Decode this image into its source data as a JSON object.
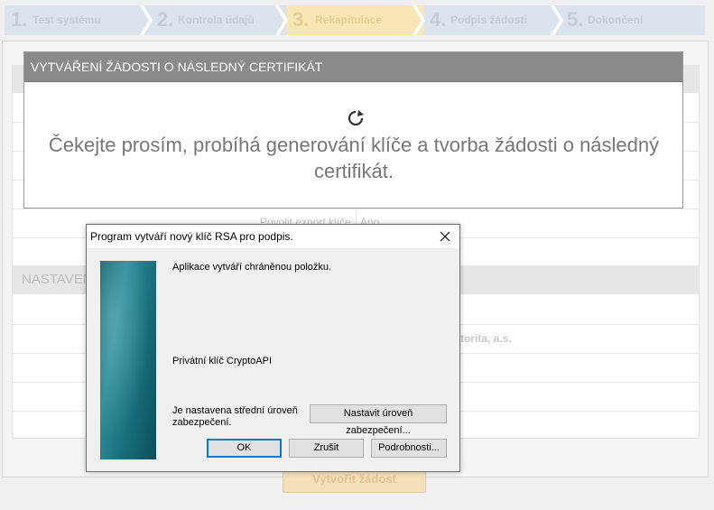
{
  "steps": [
    {
      "num": "1.",
      "label": "Test systému",
      "active": false
    },
    {
      "num": "2.",
      "label": "Kontrola údajů",
      "active": false
    },
    {
      "num": "3.",
      "label": "Rekapitulace",
      "active": true
    },
    {
      "num": "4.",
      "label": "Podpis žádosti",
      "active": false
    },
    {
      "num": "5.",
      "label": "Dokončení",
      "active": false
    }
  ],
  "form": {
    "export_label": "Povolit export klíče",
    "export_value": "Ano",
    "section_title": "NASTAVENÍ",
    "authority_value": "autorita, a.s.",
    "submit_label": "Vytvořit žádost"
  },
  "modal": {
    "title": "VYTVÁŘENÍ ŽÁDOSTI O NÁSLEDNÝ CERTIFIKÁT",
    "message": "Čekejte prosím, probíhá generování klíče a tvorba žádosti o následný certifikát."
  },
  "dialog": {
    "title": "Program vytváří nový klíč RSA pro podpis.",
    "message": "Aplikace vytváří chráněnou položku.",
    "item_label": "Privátní klíč CryptoAPI",
    "security_text": "Je nastavena střední úroveň zabezpečení.",
    "set_security_button": "Nastavit úroveň zabezpečení...",
    "ok_button": "OK",
    "cancel_button": "Zrušit",
    "details_button": "Podrobnosti..."
  }
}
